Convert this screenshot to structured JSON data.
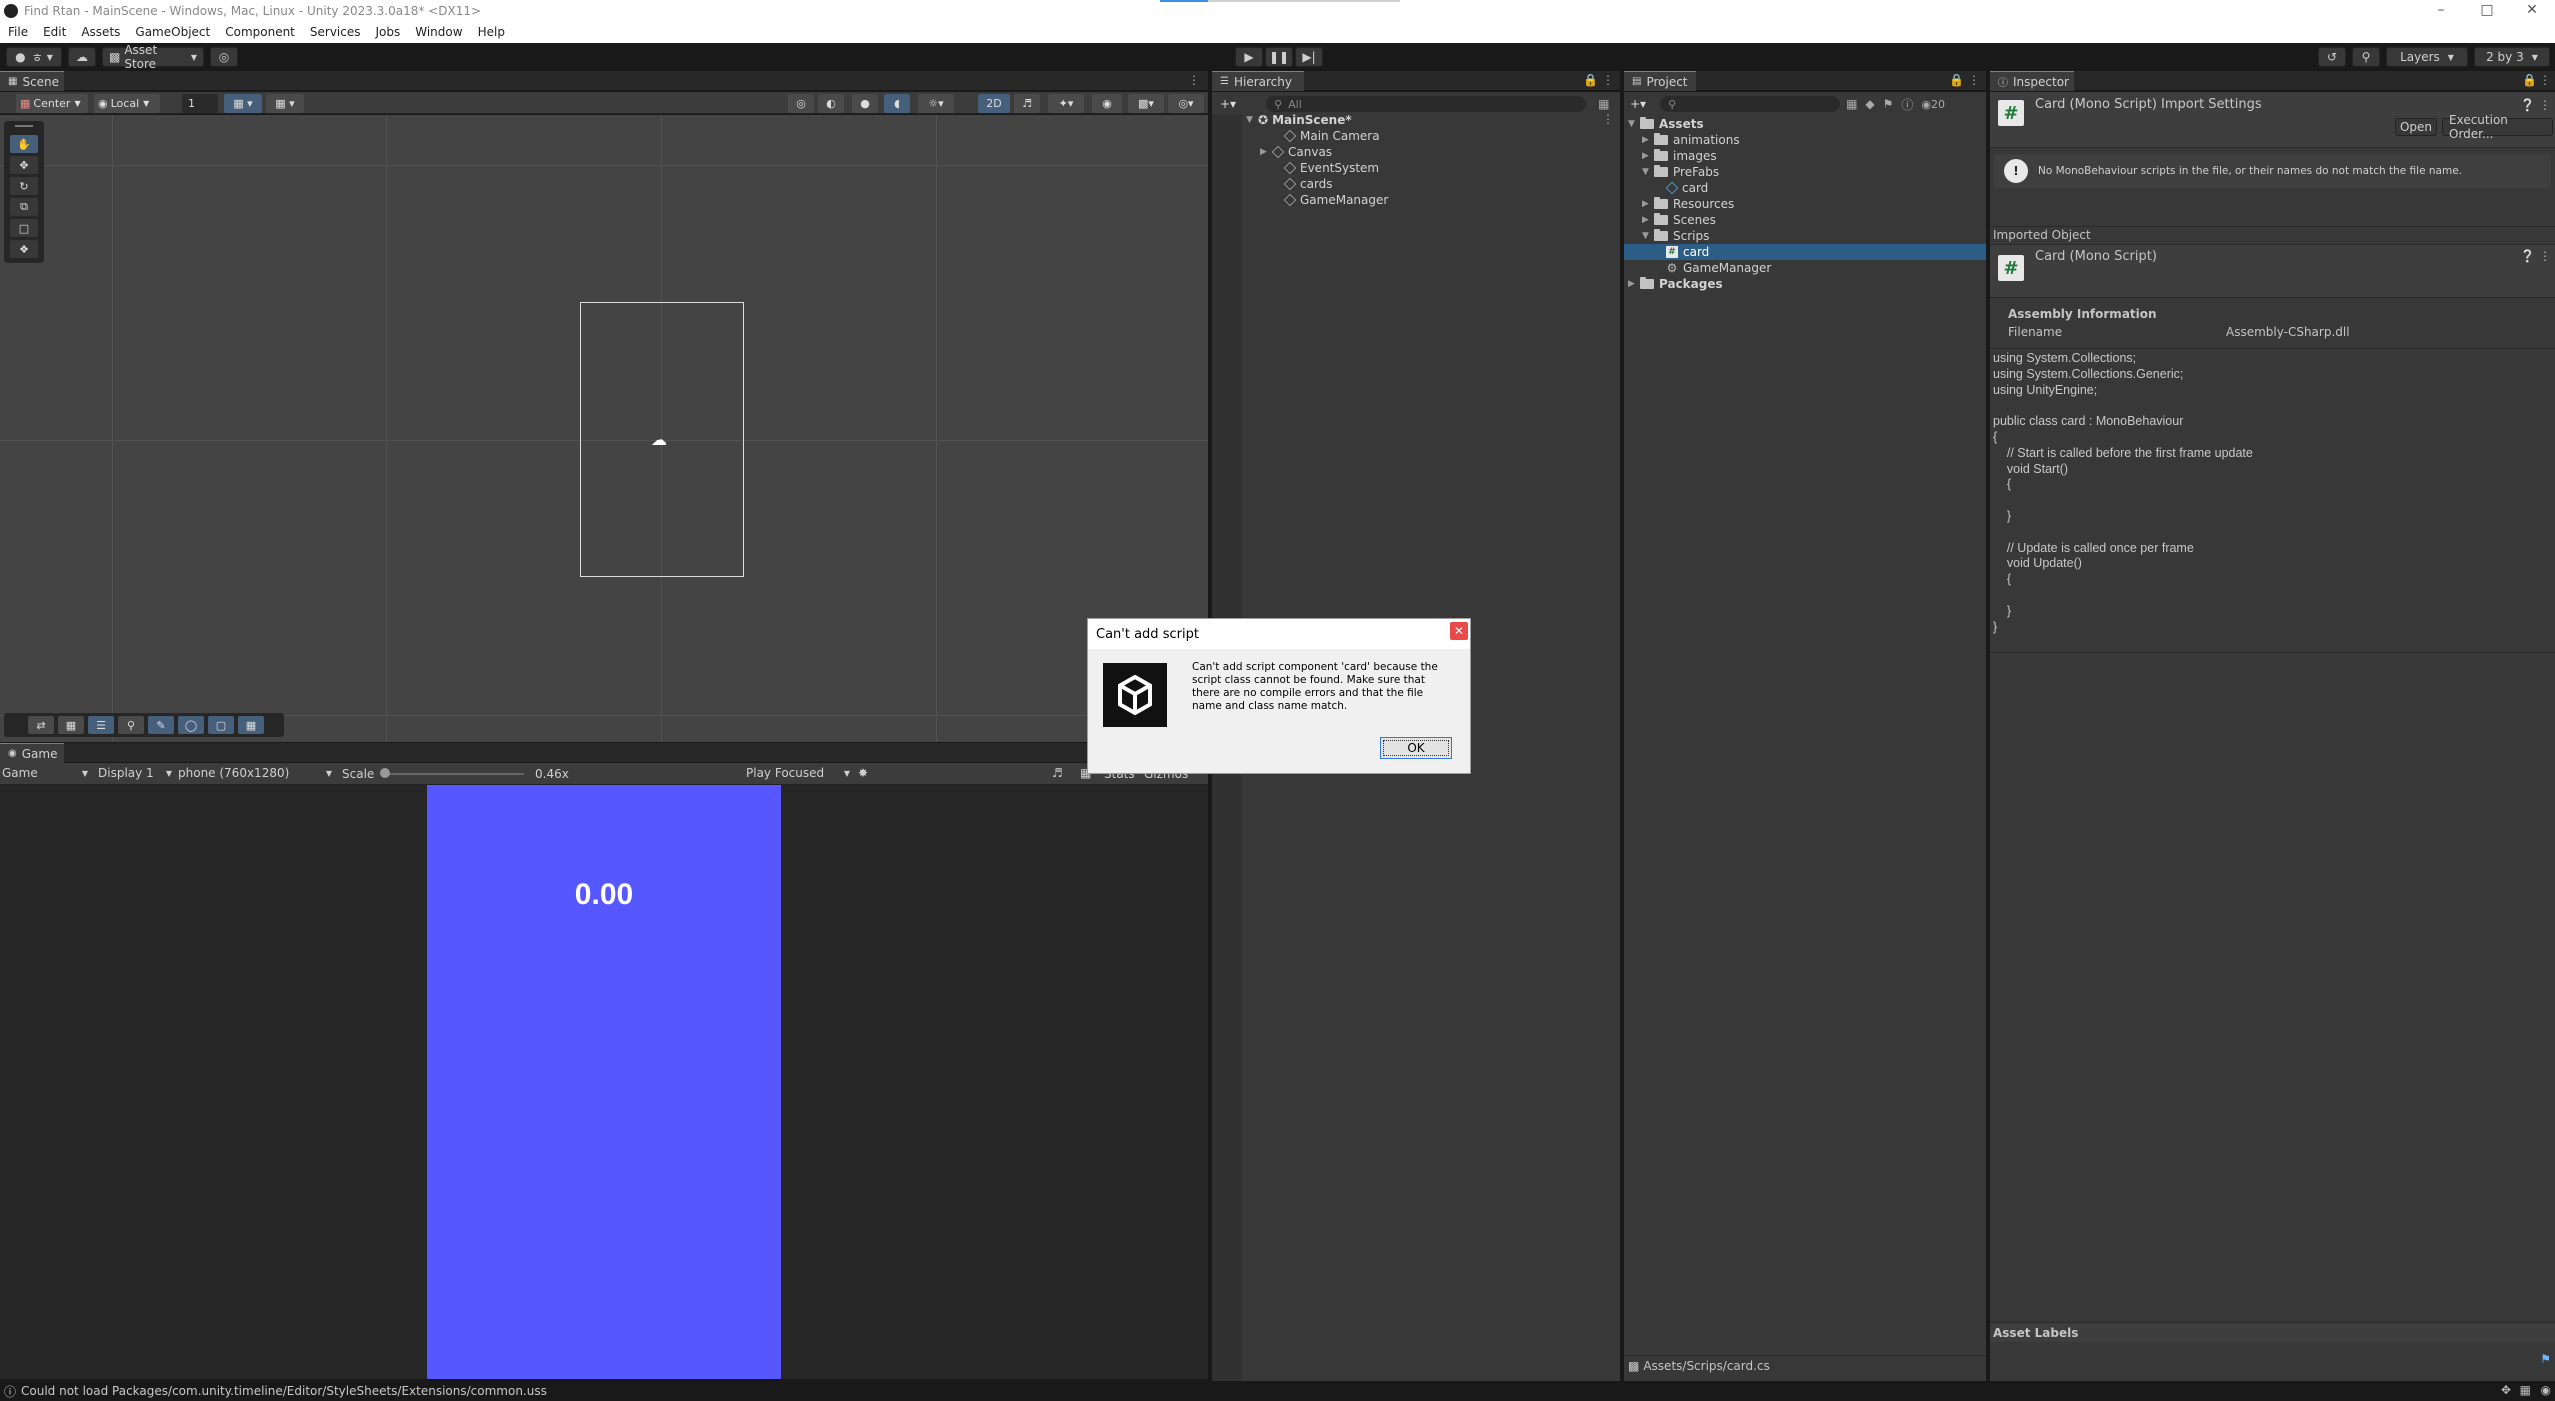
{
  "window": {
    "title": "Find Rtan - MainScene - Windows, Mac, Linux - Unity 2023.3.0a18* <DX11>",
    "min": "–",
    "max": "□",
    "close": "✕"
  },
  "menu": [
    "File",
    "Edit",
    "Assets",
    "GameObject",
    "Component",
    "Services",
    "Jobs",
    "Window",
    "Help"
  ],
  "toolbar": {
    "account": "ㅎ",
    "asset_store": "Asset Store",
    "layers": "Layers",
    "layout": "2 by 3"
  },
  "scene": {
    "tab": "Scene",
    "pivot": "Center",
    "space": "Local",
    "snap": "1",
    "mode_2d": "2D"
  },
  "game": {
    "tab": "Game",
    "view": "Game",
    "display": "Display 1",
    "resolution": "phone (760x1280)",
    "scale_label": "Scale",
    "scale_value": "0.46x",
    "play_mode": "Play Focused",
    "stats": "Stats",
    "gizmos": "Gizmos",
    "timer_text": "0.00",
    "bg_color": "#5757ff"
  },
  "hierarchy": {
    "tab": "Hierarchy",
    "search_placeholder": "All",
    "scene": "MainScene*",
    "items": [
      "Main Camera",
      "Canvas",
      "EventSystem",
      "cards",
      "GameManager"
    ]
  },
  "project": {
    "tab": "Project",
    "hidden_count": "20",
    "root": "Assets",
    "folders": {
      "animations": "animations",
      "images": "images",
      "prefabs": "PreFabs",
      "prefab_card": "card",
      "resources": "Resources",
      "scenes": "Scenes",
      "scrips": "Scrips",
      "script_card": "card",
      "script_gm": "GameManager",
      "packages": "Packages"
    },
    "path": "Assets/Scrips/card.cs"
  },
  "inspector": {
    "tab": "Inspector",
    "header": "Card (Mono Script) Import Settings",
    "open": "Open",
    "execution_order": "Execution Order...",
    "warning": "No MonoBehaviour scripts in the file, or their names do not match the file name.",
    "imported_object": "Imported Object",
    "object_name": "Card (Mono Script)",
    "assembly_info": "Assembly Information",
    "filename_label": "Filename",
    "filename_value": "Assembly-CSharp.dll",
    "code": "using System.Collections;\nusing System.Collections.Generic;\nusing UnityEngine;\n\npublic class card : MonoBehaviour\n{\n    // Start is called before the first frame update\n    void Start()\n    {\n\n    }\n\n    // Update is called once per frame\n    void Update()\n    {\n\n    }\n}",
    "asset_labels": "Asset Labels"
  },
  "dialog": {
    "title": "Can't add script",
    "message": "Can't add script component 'card' because the script class cannot be found. Make sure that there are no compile errors and that the file name and class name match.",
    "ok": "OK"
  },
  "status": {
    "message": "Could not load Packages/com.unity.timeline/Editor/StyleSheets/Extensions/common.uss"
  }
}
